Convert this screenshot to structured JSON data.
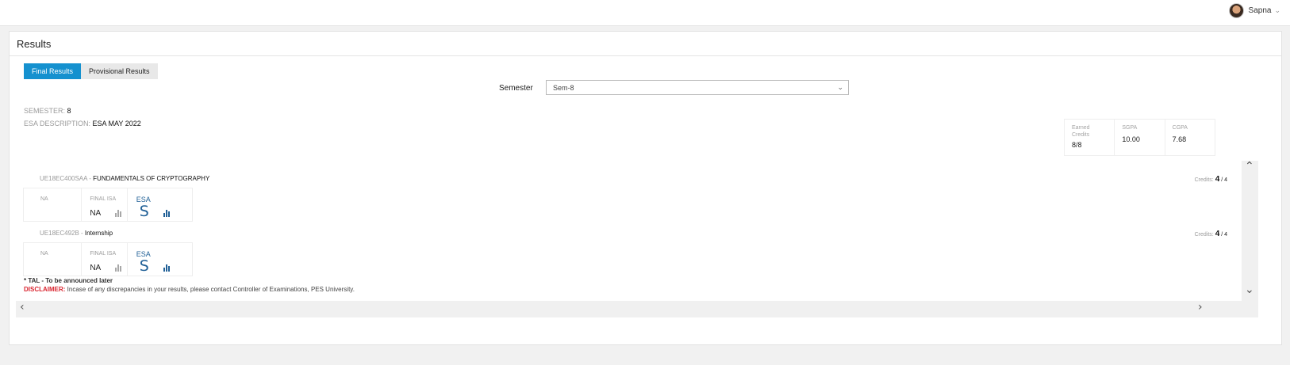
{
  "user": {
    "name": "Sapna"
  },
  "panel": {
    "title": "Results"
  },
  "tabs": [
    {
      "label": "Final Results",
      "active": true
    },
    {
      "label": "Provisional Results",
      "active": false
    }
  ],
  "semester": {
    "label": "Semester",
    "selected": "Sem-8"
  },
  "meta": {
    "semester_key": "SEMESTER:",
    "semester_value": "8",
    "esa_key": "ESA DESCRIPTION:",
    "esa_value": "ESA MAY 2022"
  },
  "summary": {
    "earned_credits_label": "Earned Credits",
    "earned_credits_value": "8/8",
    "sgpa_label": "SGPA",
    "sgpa_value": "10.00",
    "cgpa_label": "CGPA",
    "cgpa_value": "7.68"
  },
  "courses": [
    {
      "code": "UE18EC400SAA",
      "separator": " - ",
      "name": "FUNDAMENTALS OF CRYPTOGRAPHY",
      "credits_label": "Credits:",
      "credits_earned": "4",
      "credits_total": " / 4",
      "col1": "NA",
      "final_isa_label": "FINAL ISA",
      "final_isa_value": "NA",
      "esa_label": "ESA",
      "esa_grade": "S"
    },
    {
      "code": "UE18EC492B",
      "separator": " - ",
      "name": "Internship",
      "credits_label": "Credits:",
      "credits_earned": "4",
      "credits_total": " / 4",
      "col1": "NA",
      "final_isa_label": "FINAL ISA",
      "final_isa_value": "NA",
      "esa_label": "ESA",
      "esa_grade": "S"
    }
  ],
  "footnote": "* TAL - To be announced later",
  "disclaimer": {
    "label": "DISCLAIMER:",
    "text": " Incase of any discrepancies in your results, please contact Controller of Examinations, PES University."
  },
  "colors": {
    "accent": "#1591cf",
    "esa_blue": "#1f5f96",
    "disclaimer_red": "#d9232e"
  },
  "icons": [
    "avatar",
    "chevron-down-icon",
    "bar-chart-icon",
    "chevron-up-icon",
    "chevron-left-icon",
    "chevron-right-icon"
  ]
}
